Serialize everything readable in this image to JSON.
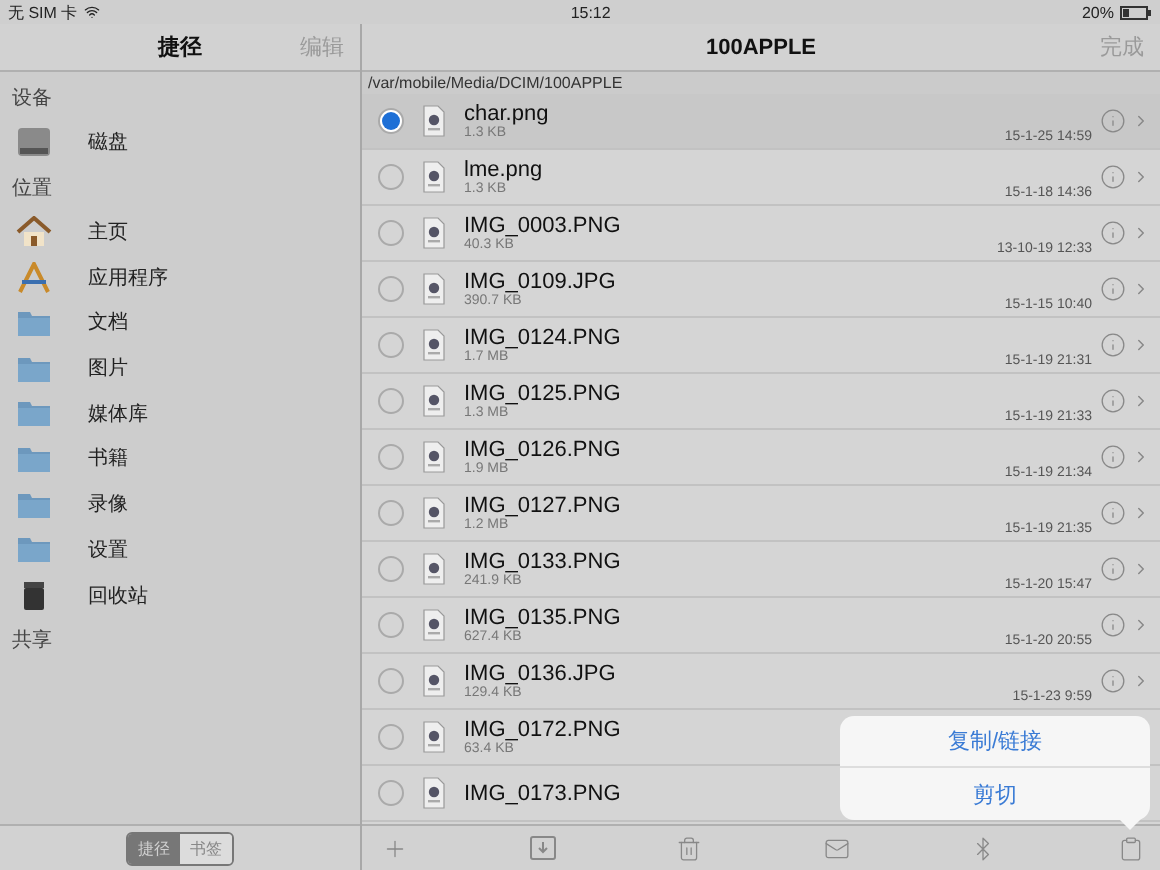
{
  "status_bar": {
    "carrier": "无 SIM 卡",
    "time": "15:12",
    "battery": "20%"
  },
  "sidebar": {
    "title": "捷径",
    "edit": "编辑",
    "sections": [
      {
        "title": "设备",
        "items": [
          {
            "label": "磁盘",
            "kind": "disk"
          }
        ]
      },
      {
        "title": "位置",
        "items": [
          {
            "label": "主页",
            "kind": "home"
          },
          {
            "label": "应用程序",
            "kind": "apps"
          },
          {
            "label": "文档",
            "kind": "folder"
          },
          {
            "label": "图片",
            "kind": "folder"
          },
          {
            "label": "媒体库",
            "kind": "folder"
          },
          {
            "label": "书籍",
            "kind": "folder"
          },
          {
            "label": "录像",
            "kind": "folder"
          },
          {
            "label": "设置",
            "kind": "folder"
          },
          {
            "label": "回收站",
            "kind": "trash"
          }
        ]
      },
      {
        "title": "共享"
      }
    ],
    "tabs": [
      {
        "label": "捷径",
        "selected": true
      },
      {
        "label": "书签",
        "selected": false
      }
    ]
  },
  "browser": {
    "title": "100APPLE",
    "done": "完成",
    "path": "/var/mobile/Media/DCIM/100APPLE",
    "files": [
      {
        "name": "char.png",
        "size": "1.3 KB",
        "date": "15-1-25 14:59",
        "selected": true
      },
      {
        "name": "lme.png",
        "size": "1.3 KB",
        "date": "15-1-18 14:36",
        "selected": false
      },
      {
        "name": "IMG_0003.PNG",
        "size": "40.3 KB",
        "date": "13-10-19 12:33",
        "selected": false
      },
      {
        "name": "IMG_0109.JPG",
        "size": "390.7 KB",
        "date": "15-1-15 10:40",
        "selected": false
      },
      {
        "name": "IMG_0124.PNG",
        "size": "1.7 MB",
        "date": "15-1-19 21:31",
        "selected": false
      },
      {
        "name": "IMG_0125.PNG",
        "size": "1.3 MB",
        "date": "15-1-19 21:33",
        "selected": false
      },
      {
        "name": "IMG_0126.PNG",
        "size": "1.9 MB",
        "date": "15-1-19 21:34",
        "selected": false
      },
      {
        "name": "IMG_0127.PNG",
        "size": "1.2 MB",
        "date": "15-1-19 21:35",
        "selected": false
      },
      {
        "name": "IMG_0133.PNG",
        "size": "241.9 KB",
        "date": "15-1-20 15:47",
        "selected": false
      },
      {
        "name": "IMG_0135.PNG",
        "size": "627.4 KB",
        "date": "15-1-20 20:55",
        "selected": false
      },
      {
        "name": "IMG_0136.JPG",
        "size": "129.4 KB",
        "date": "15-1-23 9:59",
        "selected": false
      },
      {
        "name": "IMG_0172.PNG",
        "size": "63.4 KB",
        "selected": false
      },
      {
        "name": "IMG_0173.PNG",
        "selected": false
      }
    ]
  },
  "popover": {
    "items": [
      "复制/链接",
      "剪切"
    ]
  }
}
